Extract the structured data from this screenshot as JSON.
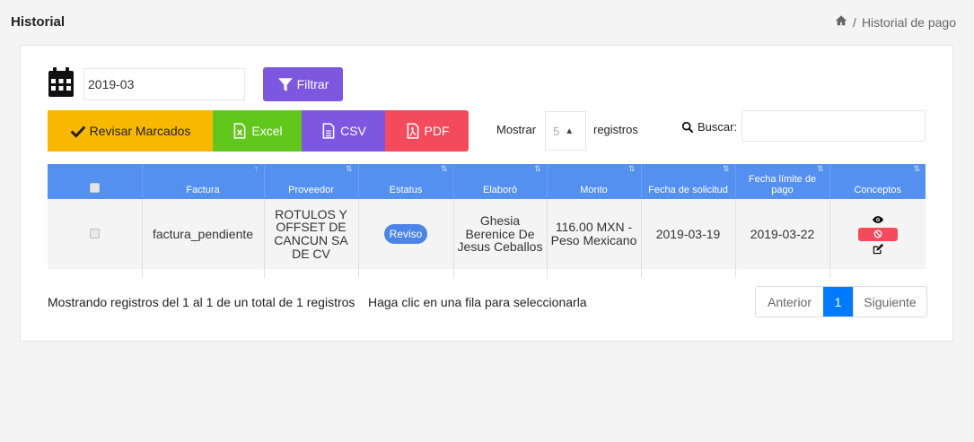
{
  "header": {
    "title": "Historial",
    "breadcrumb_sep": "/",
    "breadcrumb_current": "Historial de pago"
  },
  "filter": {
    "date_value": "2019-03",
    "filter_label": "Filtrar"
  },
  "actions": {
    "revisar_label": "Revisar Marcados",
    "excel_label": "Excel",
    "csv_label": "CSV",
    "pdf_label": "PDF"
  },
  "length": {
    "mostrar_label": "Mostrar",
    "value": "5",
    "registros_label": "registros"
  },
  "search": {
    "label": "Buscar:",
    "value": ""
  },
  "table": {
    "columns": [
      "",
      "Factura",
      "Proveedor",
      "Estatus",
      "Elaboró",
      "Monto",
      "Fecha de solicitud",
      "Fecha límite de pago",
      "Conceptos"
    ],
    "rows": [
      {
        "factura": "factura_pendiente",
        "proveedor": "ROTULOS Y OFFSET DE CANCUN SA DE CV",
        "estatus": "Reviso",
        "elaboro": "Ghesia Berenice De Jesus Ceballos",
        "monto": "116.00 MXN - Peso Mexicano",
        "fecha_solicitud": "2019-03-19",
        "fecha_limite": "2019-03-22"
      }
    ]
  },
  "footer": {
    "info": "Mostrando registros del 1 al 1 de un total de 1 registros",
    "hint": "Haga clic en una fila para seleccionarla",
    "prev_label": "Anterior",
    "current_page": "1",
    "next_label": "Siguiente"
  },
  "colors": {
    "accent_purple": "#7e57e0",
    "table_header": "#5490f0",
    "excel": "#62c71c",
    "pdf": "#f44b5c",
    "revisar": "#f9b800",
    "page_active": "#007bff"
  }
}
